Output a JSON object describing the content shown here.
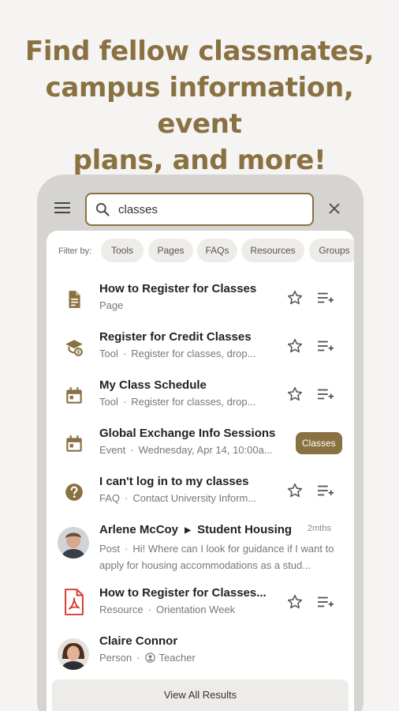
{
  "headline": [
    "Find fellow classmates,",
    "campus information, event",
    "plans, and more!"
  ],
  "search": {
    "value": "classes"
  },
  "filters": {
    "label": "Filter by:",
    "chips": [
      "Tools",
      "Pages",
      "FAQs",
      "Resources",
      "Groups"
    ]
  },
  "results": [
    {
      "title": "How to Register for Classes",
      "type": "Page",
      "detail": "",
      "icon": "document-icon"
    },
    {
      "title": "Register for Credit Classes",
      "type": "Tool",
      "detail": "Register for classes, drop...",
      "icon": "graduation-cap-icon"
    },
    {
      "title": "My Class Schedule",
      "type": "Tool",
      "detail": "Register for classes, drop...",
      "icon": "calendar-icon"
    },
    {
      "title": "Global Exchange Info Sessions",
      "type": "Event",
      "detail": "Wednesday, Apr 14, 10:00a...",
      "icon": "calendar-icon",
      "badge": "Classes"
    },
    {
      "title": "I can't log in to my classes",
      "type": "FAQ",
      "detail": "Contact University Inform...",
      "icon": "help-icon"
    },
    {
      "author": "Arlene McCoy",
      "group": "Student Housing",
      "time": "2mths",
      "type": "Post",
      "body": "Hi! Where can I look for guidance if I want to apply for housing accommodations as a stud..."
    },
    {
      "title": "How to Register for Classes...",
      "type": "Resource",
      "detail": "Orientation Week",
      "icon": "pdf-icon"
    },
    {
      "title": "Claire Connor",
      "type": "Person",
      "detail": "Teacher",
      "icon": "person-icon"
    }
  ],
  "view_all": "View All Results",
  "colors": {
    "accent": "#8a7142",
    "background": "#f5f4f2",
    "phone": "#d6d4d1"
  }
}
